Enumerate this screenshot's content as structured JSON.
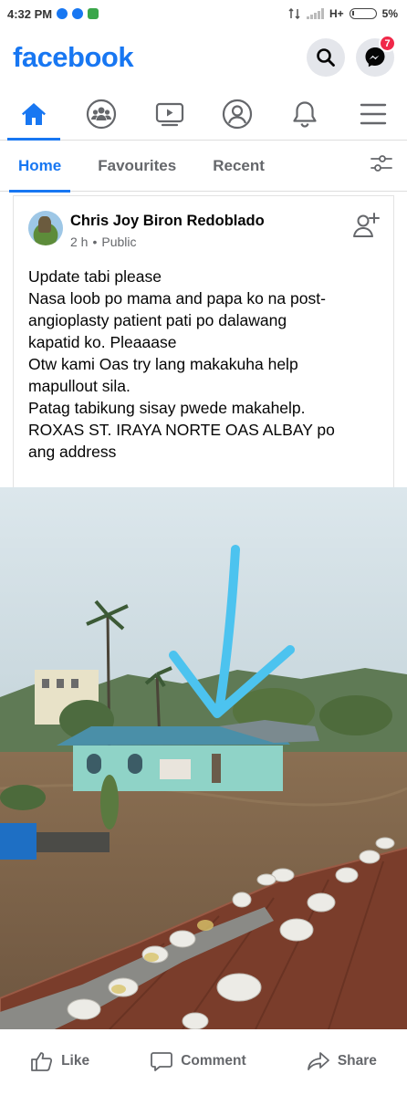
{
  "status_bar": {
    "time": "4:32 PM",
    "network": "H+",
    "battery": "5%",
    "app_icons": [
      "facebook-icon",
      "facebook-icon",
      "whatsapp-icon"
    ]
  },
  "header": {
    "logo": "facebook",
    "messenger_badge": "7",
    "brand_color": "#1877f2"
  },
  "nav": {
    "items": [
      {
        "name": "home",
        "icon": "home-icon",
        "active": true
      },
      {
        "name": "groups",
        "icon": "groups-icon",
        "active": false
      },
      {
        "name": "watch",
        "icon": "video-icon",
        "active": false
      },
      {
        "name": "profile",
        "icon": "profile-icon",
        "active": false
      },
      {
        "name": "notifications",
        "icon": "bell-icon",
        "active": false
      },
      {
        "name": "menu",
        "icon": "hamburger-menu-icon",
        "active": false
      }
    ]
  },
  "filters": {
    "home": "Home",
    "favourites": "Favourites",
    "recent": "Recent"
  },
  "post": {
    "author": "Chris Joy Biron Redoblado",
    "time": "2 h",
    "separator": "•",
    "privacy": "Public",
    "lines": [
      "Update tabi please",
      "Nasa loob po mama and papa ko na post-",
      "angioplasty patient pati po dalawang",
      "kapatid ko. Pleaaase",
      "Otw kami Oas try lang makakuha help",
      "mapullout sila.",
      "Patag tabikung sisay pwede makahelp.",
      "ROXAS ST. IRAYA NORTE OAS ALBAY po",
      "ang address"
    ]
  },
  "actions": {
    "like": "Like",
    "comment": "Comment",
    "share": "Share"
  }
}
